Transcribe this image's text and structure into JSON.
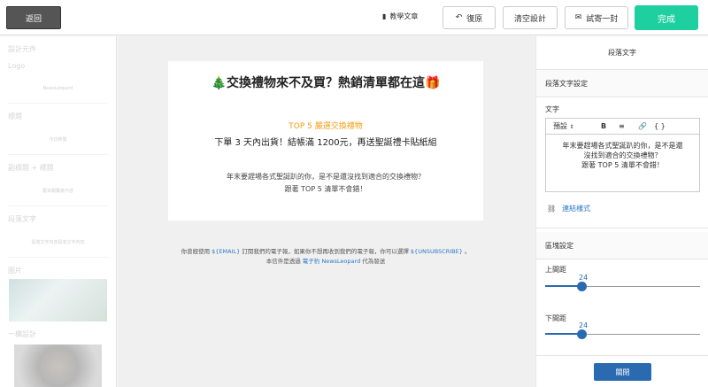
{
  "topbar": {
    "back_label": "返回",
    "tutorial_label": "教學文章",
    "undo_label": "復原",
    "clear_label": "清空設計",
    "test_send_label": "試寄一封",
    "done_label": "完成"
  },
  "left_panel": {
    "title": "設計元件",
    "sections": [
      {
        "label": "Logo",
        "preview": "NewsLeopard"
      },
      {
        "label": "標題",
        "preview": "今日新聞"
      },
      {
        "label": "副標題 + 標題",
        "preview": "跟本報獨家內容"
      },
      {
        "label": "段落文字",
        "preview": "段落文字內容段落文字內容"
      },
      {
        "label": "圖片",
        "preview": ""
      },
      {
        "label": "一欄設計",
        "preview": ""
      }
    ]
  },
  "email": {
    "title": "🎄交換禮物來不及買？熱銷清單都在這🎁",
    "subtitle": "TOP 5 嚴選交換禮物",
    "headline": "下單 3 天內出貨！結帳滿 1200元，再送聖誕禮卡貼紙組",
    "body_line1": "年末要趕場各式聖誕趴的你，是不是還沒找到適合的交換禮物？",
    "body_line2": "跟著 TOP 5 清單不會錯！",
    "footer_a": "你曾經使用",
    "footer_email": "${EMAIL}",
    "footer_b": "訂閱我們的電子報，如果你不想再收到我們的電子報，你可以選擇",
    "footer_unsub": "${UNSUBSCRIBE}",
    "footer_c": "。",
    "footer_d": "本信件是透過",
    "footer_link": "電子豹 NewsLeopard",
    "footer_e": "代為發送"
  },
  "right_panel": {
    "header": "段落文字",
    "section_paragraph": "段落文字設定",
    "text_label": "文字",
    "toolbar": {
      "format": "預設",
      "bold": "B",
      "align": "≡",
      "link": "🔗",
      "code": "{ }"
    },
    "editor_line1": "年末要趕場各式聖誕趴的你，是不是還",
    "editor_line2": "沒找到適合的交換禮物？",
    "editor_line3": "跟著 TOP 5 清單不會錯！",
    "link_style_label": "連結樣式",
    "section_block": "區塊設定",
    "top_padding_label": "上間距",
    "top_padding_value": "24",
    "bottom_padding_label": "下間距",
    "bottom_padding_value": "24",
    "close_label": "關閉"
  }
}
